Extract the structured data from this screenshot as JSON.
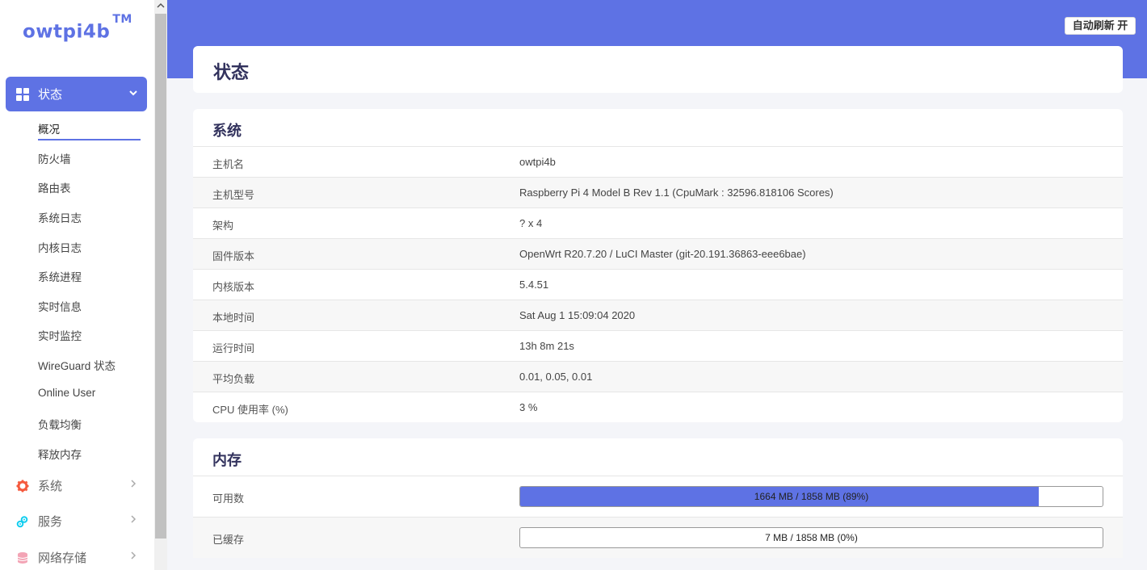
{
  "logo": {
    "text": "owtpi4b",
    "tm": "TM"
  },
  "header": {
    "refresh_label": "自动刷新 开"
  },
  "sidebar": {
    "status_label": "状态",
    "sub_items": [
      "概况",
      "防火墙",
      "路由表",
      "系统日志",
      "内核日志",
      "系统进程",
      "实时信息",
      "实时监控",
      "WireGuard 状态",
      "Online User",
      "负载均衡",
      "释放内存"
    ],
    "active_sub": "概况",
    "top_items": [
      {
        "label": "系统",
        "icon": "gear-icon",
        "color": "#f5593d"
      },
      {
        "label": "服务",
        "icon": "cogs-icon",
        "color": "#11cdef"
      },
      {
        "label": "网络存储",
        "icon": "database-icon",
        "color": "#f3a4b5"
      }
    ]
  },
  "page": {
    "title": "状态"
  },
  "system": {
    "title": "系统",
    "rows": [
      {
        "k": "主机名",
        "v": "owtpi4b"
      },
      {
        "k": "主机型号",
        "v": "Raspberry Pi 4 Model B Rev 1.1 (CpuMark : 32596.818106 Scores)"
      },
      {
        "k": "架构",
        "v": "? x 4"
      },
      {
        "k": "固件版本",
        "v": "OpenWrt R20.7.20 / LuCI Master (git-20.191.36863-eee6bae)"
      },
      {
        "k": "内核版本",
        "v": "5.4.51"
      },
      {
        "k": "本地时间",
        "v": "Sat Aug 1 15:09:04 2020"
      },
      {
        "k": "运行时间",
        "v": "13h 8m 21s"
      },
      {
        "k": "平均负载",
        "v": "0.01, 0.05, 0.01"
      },
      {
        "k": "CPU 使用率 (%)",
        "v": "3 %"
      }
    ]
  },
  "memory": {
    "title": "内存",
    "rows": [
      {
        "k": "可用数",
        "text": "1664 MB / 1858 MB (89%)",
        "percent": 89
      },
      {
        "k": "已缓存",
        "text": "7 MB / 1858 MB (0%)",
        "percent": 0
      }
    ]
  },
  "colors": {
    "accent": "#5e72e4"
  }
}
